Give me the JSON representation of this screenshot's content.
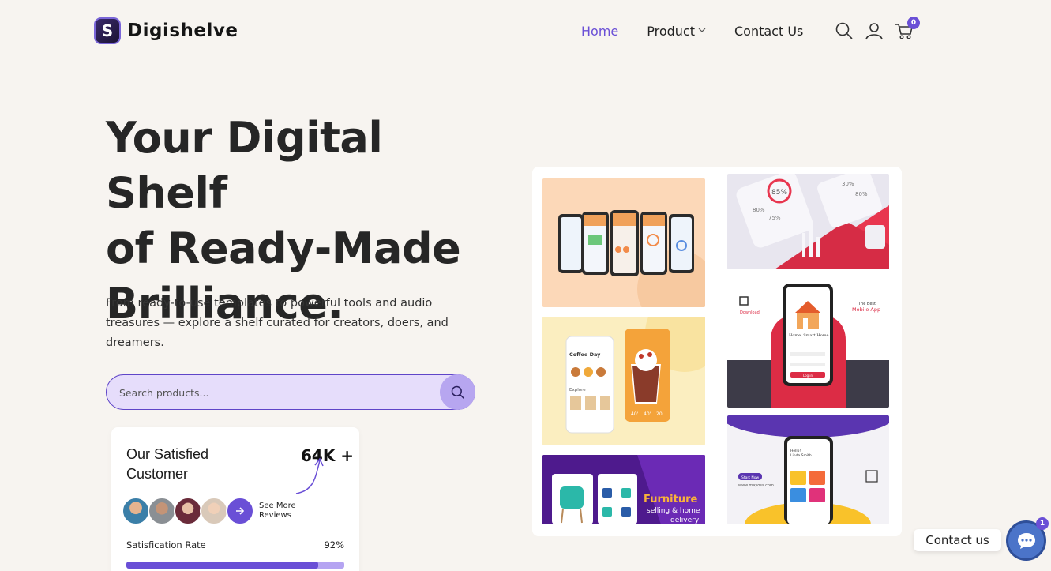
{
  "brand": {
    "name": "Digishelve",
    "logo_letter": "S"
  },
  "nav": {
    "items": [
      {
        "label": "Home",
        "active": true
      },
      {
        "label": "Product",
        "has_dropdown": true
      },
      {
        "label": "Contact Us"
      }
    ],
    "icons": [
      "search-icon",
      "user-icon",
      "cart-icon"
    ],
    "cart_count": "0"
  },
  "hero": {
    "title_lines": [
      "Your Digital Shelf",
      "of Ready-Made",
      "Brilliance."
    ],
    "subtitle": "From ready-to-use templates to powerful tools and audio treasures — explore a shelf curated for creators, doers, and dreamers.",
    "search_placeholder": "Search products..."
  },
  "customers": {
    "title_line1": "Our Satisfied",
    "title_line2": "Customer",
    "count": "64K +",
    "see_more_line1": "See More",
    "see_more_line2": "Reviews",
    "rate_label": "Satisfication Rate",
    "rate_value": "92%",
    "rate_fraction": 0.88
  },
  "gallery": {
    "tiles": [
      {
        "name": "phones-dashboard",
        "texts": []
      },
      {
        "name": "stats-app",
        "texts": [
          "85%",
          "80%",
          "75%",
          "30%",
          "80%"
        ]
      },
      {
        "name": "coffee-app",
        "texts": [
          "Coffee Day",
          "Explore",
          "40'",
          "40'",
          "20'"
        ]
      },
      {
        "name": "home-app",
        "texts": [
          "The Best",
          "Mobile App",
          "Download",
          "Home, Smart Home",
          "Log in"
        ]
      },
      {
        "name": "furniture-app",
        "texts": [
          "Furniture",
          "selling & home",
          "delivery"
        ]
      },
      {
        "name": "wallet-app",
        "texts": [
          "Hello!",
          "Linda Smith",
          "Start Now",
          "www.mayoss.com"
        ]
      }
    ]
  },
  "contact_widget": {
    "label": "Contact us",
    "badge": "1"
  },
  "colors": {
    "accent": "#6a4fd6",
    "background": "#f7f4f0",
    "search_bg": "#e6ddfb"
  }
}
